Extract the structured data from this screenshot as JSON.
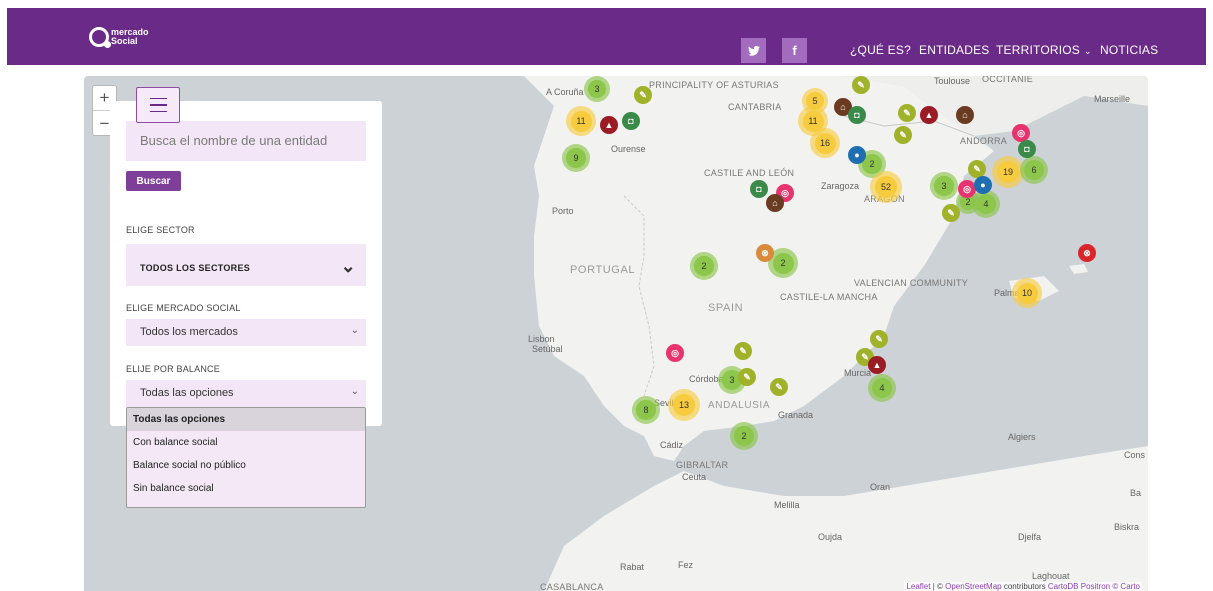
{
  "header": {
    "logo_text_line1": "mercado",
    "logo_text_line2": "Social",
    "twitter_icon": "twitter-icon",
    "facebook_icon": "facebook-icon",
    "nav": [
      {
        "label": "¿QUÉ ES?"
      },
      {
        "label": "ENTIDADES"
      },
      {
        "label": "TERRITORIOS"
      },
      {
        "label": "NOTICIAS"
      }
    ],
    "bg_color": "#6a2a87"
  },
  "panel": {
    "zoom_in": "+",
    "zoom_out": "−",
    "search_placeholder": "Busca el nombre de una entidad",
    "search_button": "Buscar",
    "sector_label": "ELIGE SECTOR",
    "sector_value": "TODOS LOS SECTORES",
    "mercado_label": "ELIGE MERCADO SOCIAL",
    "mercado_value": "Todos los mercados",
    "balance_label": "ELIJE POR BALANCE",
    "balance_value": "Todas las opciones",
    "balance_options": [
      "Todas las opciones",
      "Con balance social",
      "Balance social no público",
      "Sin balance social"
    ],
    "accent": "#7d3f98"
  },
  "map": {
    "labels": {
      "principality": "PRINCIPALITY OF ASTURIAS",
      "cantabria": "CANTABRIA",
      "castile": "CASTILE AND LEÓN",
      "portugal": "PORTUGAL",
      "spain": "SPAIN",
      "castile_la_mancha": "CASTILE-LA MANCHA",
      "valencian": "VALENCIAN COMMUNITY",
      "andalusia": "ANDALUSIA",
      "aragon": "ARAGON",
      "andorra": "ANDORRA",
      "occitanie": "OCCITANIE",
      "gibraltar": "GIBRALTAR",
      "casablanca": "CASABLANCA",
      "a_coruna": "A Coruña",
      "ourense": "Ourense",
      "porto": "Porto",
      "lisbon": "Lisbon",
      "setubal": "Setúbal",
      "zaragoza": "Zaragoza",
      "toulouse": "Toulouse",
      "marseille": "Marseille",
      "palma": "Palma",
      "cordoba": "Córdoba",
      "sevilla": "Sevilla",
      "granada": "Granada",
      "murcia": "Murcia",
      "cadiz": "Cádiz",
      "ceuta": "Ceuta",
      "melilla": "Melilla",
      "oujda": "Oujda",
      "oran": "Oran",
      "algiers": "Algiers",
      "djelfa": "Djelfa",
      "biskra": "Biskra",
      "laghouat": "Laghouat",
      "rabat": "Rabat",
      "fez": "Fez",
      "cons": "Cons",
      "ba": "Ba"
    },
    "clusters": [
      {
        "count": "3",
        "color": "green"
      },
      {
        "count": "11",
        "color": "yellow"
      },
      {
        "count": "9",
        "color": "green"
      },
      {
        "count": "11",
        "color": "yellow"
      },
      {
        "count": "16",
        "color": "yellow"
      },
      {
        "count": "2",
        "color": "green"
      },
      {
        "count": "52",
        "color": "yellow"
      },
      {
        "count": "3",
        "color": "green"
      },
      {
        "count": "19",
        "color": "yellow"
      },
      {
        "count": "6",
        "color": "green"
      },
      {
        "count": "2",
        "color": "green"
      },
      {
        "count": "4",
        "color": "green"
      },
      {
        "count": "2",
        "color": "green"
      },
      {
        "count": "2",
        "color": "green"
      },
      {
        "count": "10",
        "color": "yellow"
      },
      {
        "count": "3",
        "color": "green"
      },
      {
        "count": "8",
        "color": "green"
      },
      {
        "count": "13",
        "color": "yellow"
      },
      {
        "count": "2",
        "color": "green"
      },
      {
        "count": "4",
        "color": "green"
      },
      {
        "count": "5",
        "color": "yellow"
      }
    ],
    "attribution": {
      "leaflet": "Leaflet",
      "sep": " | © ",
      "osm": "OpenStreetMap",
      "contributors": " contributors ",
      "carto": "CartoDB Positron © Carto"
    }
  }
}
